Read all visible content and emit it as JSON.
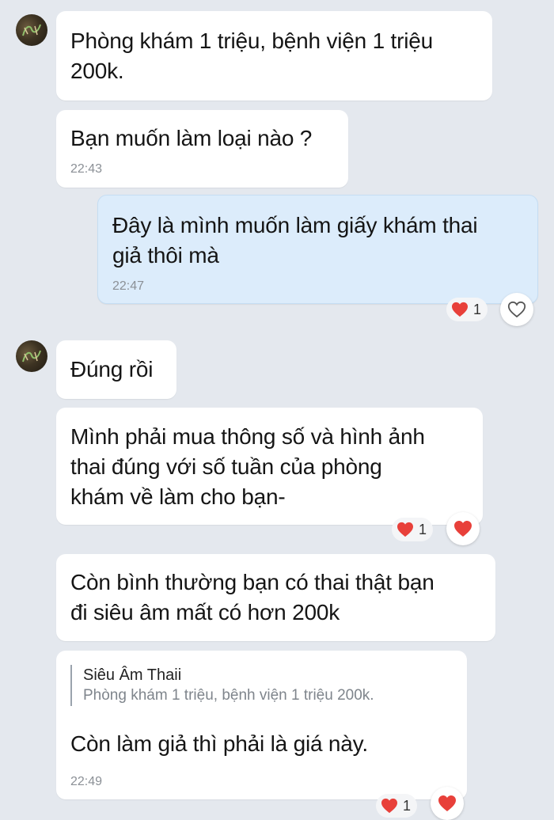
{
  "colors": {
    "background": "#e4e8ee",
    "received_bubble": "#ffffff",
    "sent_bubble": "#dcecfb",
    "heart": "#e8403a",
    "timestamp": "#8b9096"
  },
  "messages": [
    {
      "text": "Phòng khám 1 triệu, bệnh viện 1 triệu\n200k."
    },
    {
      "text": "Bạn muốn làm loại nào ?",
      "time": "22:43"
    },
    {
      "text": "Đây là mình muốn làm giấy khám thai\ngiả thôi mà",
      "time": "22:47",
      "reaction": {
        "icon": "heart-icon",
        "count": "1"
      },
      "react_button_icon": "heart-outline-icon"
    },
    {
      "text": "Đúng rồi"
    },
    {
      "text": "Mình phải mua thông số và hình ảnh\nthai đúng với số tuần của phòng\nkhám về làm cho bạn-",
      "reaction": {
        "icon": "heart-icon",
        "count": "1"
      },
      "react_button_icon": "heart-filled-icon"
    },
    {
      "text": "Còn bình thường bạn có thai thật bạn\nđi siêu âm mất có hơn 200k"
    },
    {
      "quote": {
        "name": "Siêu Âm Thaii",
        "text": "Phòng khám 1 triệu, bệnh viện 1 triệu 200k."
      },
      "text": "Còn làm giả thì phải là giá này.",
      "time": "22:49",
      "reaction": {
        "icon": "heart-icon",
        "count": "1"
      },
      "react_button_icon": "heart-filled-icon"
    }
  ]
}
